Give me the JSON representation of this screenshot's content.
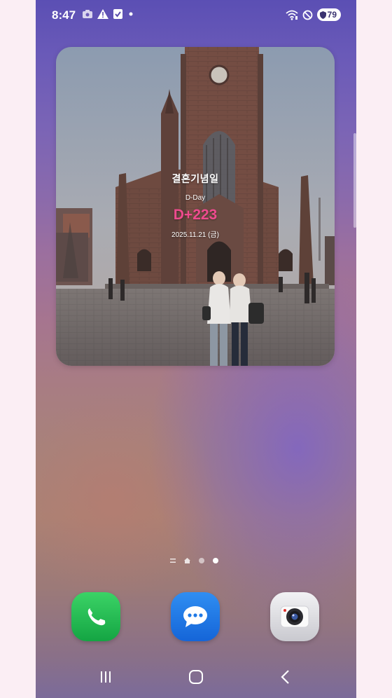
{
  "status_bar": {
    "time": "8:47",
    "battery": "79",
    "left_icons": [
      "camera-icon",
      "warning-icon",
      "checkbox-icon",
      "dot-icon"
    ],
    "right_icons": [
      "wifi-icon",
      "do-not-disturb-icon",
      "battery-icon"
    ]
  },
  "widget": {
    "title": "결혼기념일",
    "subtitle": "D-Day",
    "count": "D+223",
    "date": "2025.11.21 (금)",
    "accent_color": "#ee4b8e"
  },
  "pager": {
    "page_count": 3,
    "active_index": 2
  },
  "dock": {
    "apps": [
      "phone-icon",
      "messages-icon",
      "camera-icon"
    ]
  },
  "navbar": {
    "buttons": [
      "recent-apps-icon",
      "home-icon",
      "back-icon"
    ]
  },
  "colors": {
    "status_text": "#ffffff",
    "phone_app": "#1fb84f",
    "messages_app": "#1f79e6",
    "camera_app": "#dcdce0"
  }
}
